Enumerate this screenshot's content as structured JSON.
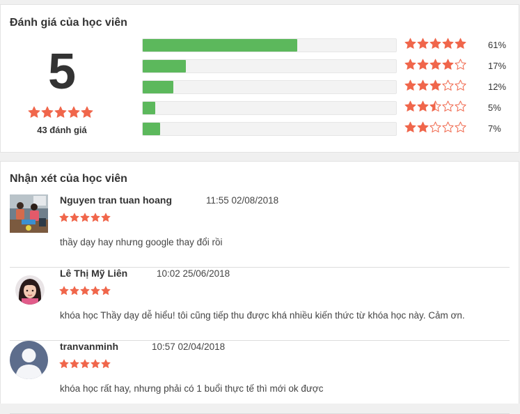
{
  "rating": {
    "title": "Đánh giá của học viên",
    "average": "5",
    "summary_stars": 5,
    "count_label": "43 đánh giá",
    "breakdown": [
      {
        "stars": 5,
        "percent": 61,
        "label": "61%"
      },
      {
        "stars": 4,
        "percent": 17,
        "label": "17%"
      },
      {
        "stars": 3,
        "percent": 12,
        "label": "12%"
      },
      {
        "stars": 2.5,
        "percent": 5,
        "label": "5%"
      },
      {
        "stars": 2,
        "percent": 7,
        "label": "7%"
      }
    ]
  },
  "reviews": {
    "title": "Nhận xét của học viên",
    "items": [
      {
        "name": "Nguyen tran tuan hoang",
        "time": "11:55 02/08/2018",
        "stars": 5,
        "text": "thầy dạy hay nhưng google thay đổi rồi",
        "avatar": "classroom-photo"
      },
      {
        "name": "Lê Thị Mỹ Liên",
        "time": "10:02 25/06/2018",
        "stars": 5,
        "text": "khóa học Thầy dạy dễ hiểu! tôi cũng tiếp thu được khá nhiều kiến thức từ khóa học này. Cảm ơn.",
        "avatar": "girl-portrait"
      },
      {
        "name": "tranvanminh",
        "time": "10:57 02/04/2018",
        "stars": 5,
        "text": "khóa học rất hay, nhưng phải có 1 buổi thực tế thì mới ok được",
        "avatar": "default-user-silhouette"
      }
    ]
  },
  "colors": {
    "star": "#f0664b",
    "bar_fill": "#5cb85c",
    "bar_track": "#f3f3f3"
  }
}
